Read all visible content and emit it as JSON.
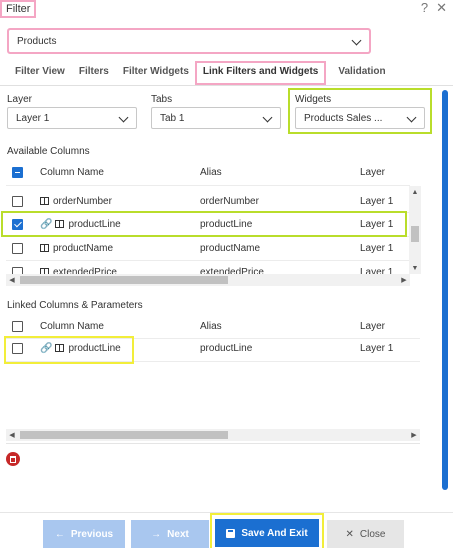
{
  "window": {
    "title": "Filter",
    "help_glyph": "?",
    "close_glyph": "✕"
  },
  "filter_select": {
    "value": "Products"
  },
  "tabs": [
    {
      "label": "Filter View"
    },
    {
      "label": "Filters"
    },
    {
      "label": "Filter Widgets"
    },
    {
      "label": "Link Filters and Widgets",
      "active": true
    },
    {
      "label": "Validation"
    }
  ],
  "selectors": {
    "layer": {
      "label": "Layer",
      "value": "Layer 1"
    },
    "tabs": {
      "label": "Tabs",
      "value": "Tab 1"
    },
    "widgets": {
      "label": "Widgets",
      "value": "Products Sales ..."
    }
  },
  "available": {
    "title": "Available Columns",
    "headers": {
      "column": "Column Name",
      "alias": "Alias",
      "layer": "Layer"
    },
    "rows": [
      {
        "name": "orderNumber",
        "alias": "orderNumber",
        "layer": "Layer 1",
        "checked": false,
        "linked": false
      },
      {
        "name": "productLine",
        "alias": "productLine",
        "layer": "Layer 1",
        "checked": true,
        "linked": true
      },
      {
        "name": "productName",
        "alias": "productName",
        "layer": "Layer 1",
        "checked": false,
        "linked": false
      },
      {
        "name": "extendedPrice",
        "alias": "extendedPrice",
        "layer": "Layer 1",
        "checked": false,
        "linked": false
      }
    ]
  },
  "linked": {
    "title": "Linked Columns & Parameters",
    "headers": {
      "column": "Column Name",
      "alias": "Alias",
      "layer": "Layer"
    },
    "rows": [
      {
        "name": "productLine",
        "alias": "productLine",
        "layer": "Layer 1",
        "checked": false,
        "linked": true
      }
    ]
  },
  "footer": {
    "previous": "Previous",
    "next": "Next",
    "save": "Save And Exit",
    "close": "Close"
  },
  "colors": {
    "primary": "#1b6fd1",
    "primary_disabled": "#a9c7ef",
    "highlight_pink": "#f4a6c4",
    "highlight_green": "#b9dd2b",
    "highlight_yellow": "#f2ee3a",
    "delete_red": "#c62828"
  }
}
